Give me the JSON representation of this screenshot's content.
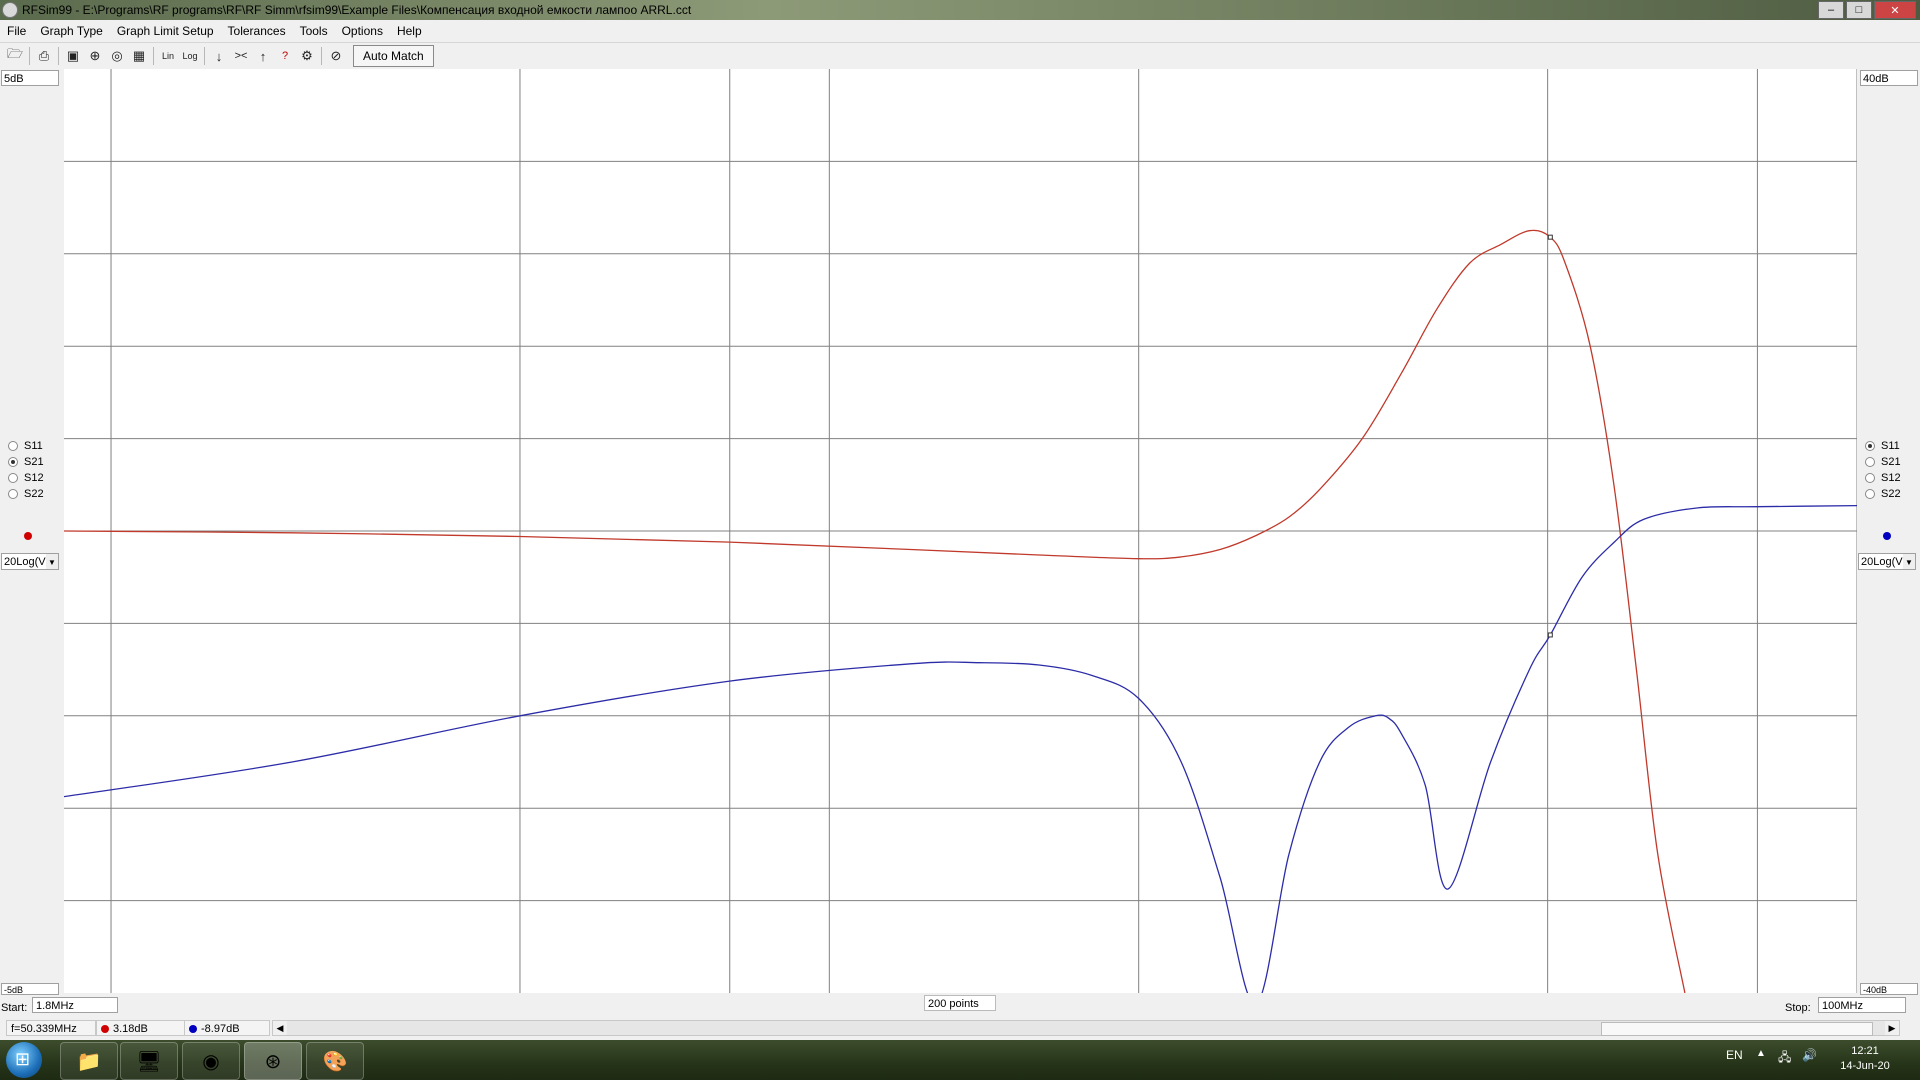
{
  "window": {
    "title": "RFSim99 - E:\\Programs\\RF programs\\RF\\RF Simm\\rfsim99\\Example Files\\Компенсация входной емкости лампоо ARRL.cct"
  },
  "menu": [
    "File",
    "Graph Type",
    "Graph Limit Setup",
    "Tolerances",
    "Tools",
    "Options",
    "Help"
  ],
  "toolbar": {
    "icons": [
      "open-file-icon",
      "print-icon",
      "graph-icon",
      "smith-chart-icon",
      "polar-icon",
      "table-icon",
      "lin-scale-icon",
      "log-scale-icon",
      "arrow-down-icon",
      "converge-icon",
      "arrow-up-icon",
      "help-cursor-icon",
      "settings-icon",
      "tune-icon"
    ],
    "auto_match": "Auto Match"
  },
  "left_axis": {
    "top_label": "5dB",
    "bottom_label": "-5dB",
    "format": "20Log(V"
  },
  "right_axis": {
    "top_label": "40dB",
    "bottom_label": "-40dB",
    "format": "20Log(V"
  },
  "params": [
    "S11",
    "S21",
    "S12",
    "S22"
  ],
  "left_selected": "S21",
  "right_selected": "S11",
  "sweep": {
    "start_label": "Start:",
    "start": "1.8MHz",
    "points": "200 points",
    "stop_label": "Stop:",
    "stop": "100MHz"
  },
  "status": {
    "freq": "f=50.339MHz",
    "red_value": "3.18dB",
    "blue_value": "-8.97dB"
  },
  "colors": {
    "red_trace": "#c0392b",
    "blue_trace": "#2c2ca8",
    "grid": "#808080"
  },
  "chart_data": {
    "type": "line",
    "title": "",
    "xlabel": "",
    "ylabel": "",
    "xlim": [
      1.8,
      100
    ],
    "xscale": "log",
    "grid": true,
    "legend": "none",
    "series": [
      {
        "name": "S21",
        "axis": "left",
        "unit": "dB",
        "ylim": [
          -5,
          5
        ],
        "color": "#c0392b",
        "x": [
          1.8,
          3,
          5,
          8,
          12,
          16,
          20,
          22,
          24,
          26,
          28,
          30,
          33,
          36,
          39,
          42,
          45,
          48,
          50.3,
          52,
          55,
          58,
          61,
          64,
          68
        ],
        "y": [
          0.0,
          -0.02,
          -0.06,
          -0.12,
          -0.2,
          -0.26,
          -0.3,
          -0.28,
          -0.2,
          -0.05,
          0.15,
          0.45,
          1.0,
          1.7,
          2.4,
          2.9,
          3.1,
          3.25,
          3.18,
          2.9,
          2.0,
          0.5,
          -1.5,
          -3.5,
          -5.0
        ]
      },
      {
        "name": "S11",
        "axis": "right",
        "unit": "dB",
        "ylim": [
          -40,
          40
        ],
        "color": "#2c2ca8",
        "x": [
          1.8,
          3,
          5,
          8,
          12,
          14,
          16,
          18,
          20,
          22,
          24,
          26,
          28,
          30,
          32,
          34,
          35,
          36,
          38,
          40,
          44,
          48,
          50.3,
          54,
          58,
          62,
          70,
          80,
          100
        ],
        "y": [
          -23,
          -20,
          -16,
          -13,
          -11.5,
          -11.4,
          -11.6,
          -12.5,
          -14.5,
          -20,
          -30,
          -41,
          -28,
          -20,
          -17,
          -16,
          -16.2,
          -17.5,
          -22,
          -31,
          -20,
          -12,
          -9,
          -4,
          -1,
          1,
          2,
          2.1,
          2.2
        ]
      }
    ]
  }
}
